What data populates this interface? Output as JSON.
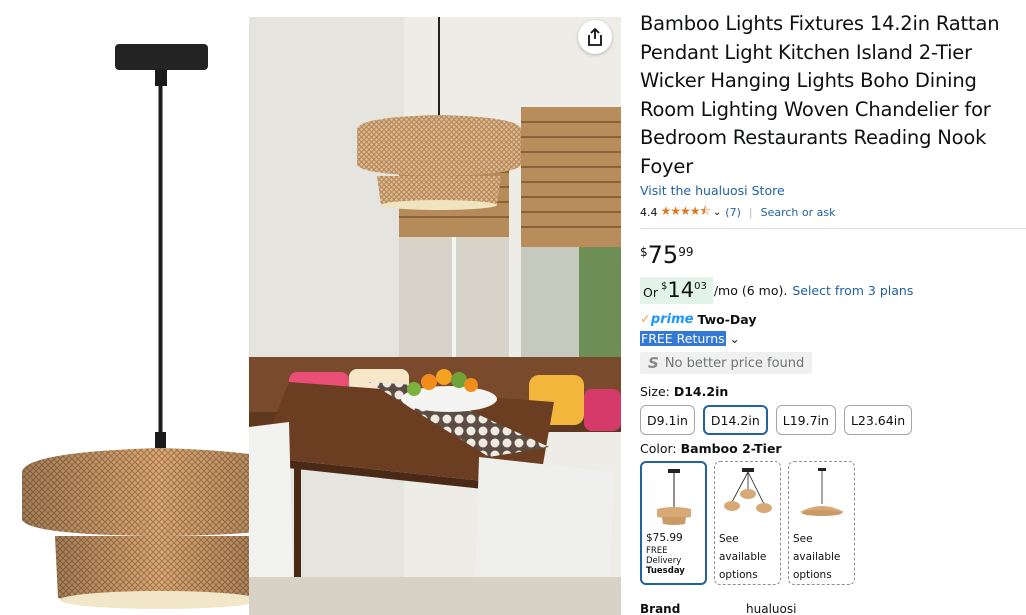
{
  "product": {
    "title": "Bamboo Lights Fixtures 14.2in Rattan Pendant Light Kitchen Island 2-Tier Wicker Hanging Lights Boho Dining Room Lighting Woven Chandelier for Bedroom Restaurants Reading Nook Foyer",
    "store_link": "Visit the hualuosi Store",
    "rating": "4.4",
    "stars": "★★★★⯪",
    "rating_count": "(7)",
    "search_ask": "Search or ask"
  },
  "price": {
    "symbol": "$",
    "whole": "75",
    "fraction": "99"
  },
  "monthly": {
    "prefix": "Or",
    "symbol": "$",
    "whole": "14",
    "fraction": "03",
    "suffix": "/mo (6 mo).",
    "plans_link": "Select from 3 plans"
  },
  "delivery": {
    "prime_check": "✓",
    "prime_word": "prime",
    "speed": "Two-Day",
    "returns": "FREE Returns"
  },
  "no_better_price": {
    "icon": "S",
    "text": "No better price found"
  },
  "size": {
    "label": "Size:",
    "selected": "D14.2in",
    "options": [
      "D9.1in",
      "D14.2in",
      "L19.7in",
      "L23.64in"
    ]
  },
  "color": {
    "label": "Color:",
    "selected": "Bamboo 2-Tier",
    "swatches": [
      {
        "price": "$75.99",
        "delivery": "FREE Delivery",
        "day": "Tuesday"
      },
      {
        "see1": "See",
        "see2": "available",
        "see3": "options"
      },
      {
        "see1": "See",
        "see2": "available",
        "see3": "options"
      }
    ]
  },
  "details": {
    "brand_label": "Brand",
    "brand_value": "hualuosi"
  },
  "icons": {
    "share": "share-icon",
    "chevron": "chevron-down-icon"
  },
  "colors": {
    "link": "#2162a1",
    "star": "#de7921",
    "prime": "#1a98ff",
    "selected_border": "#2162a1",
    "installment_bg": "#e2f4e9"
  }
}
